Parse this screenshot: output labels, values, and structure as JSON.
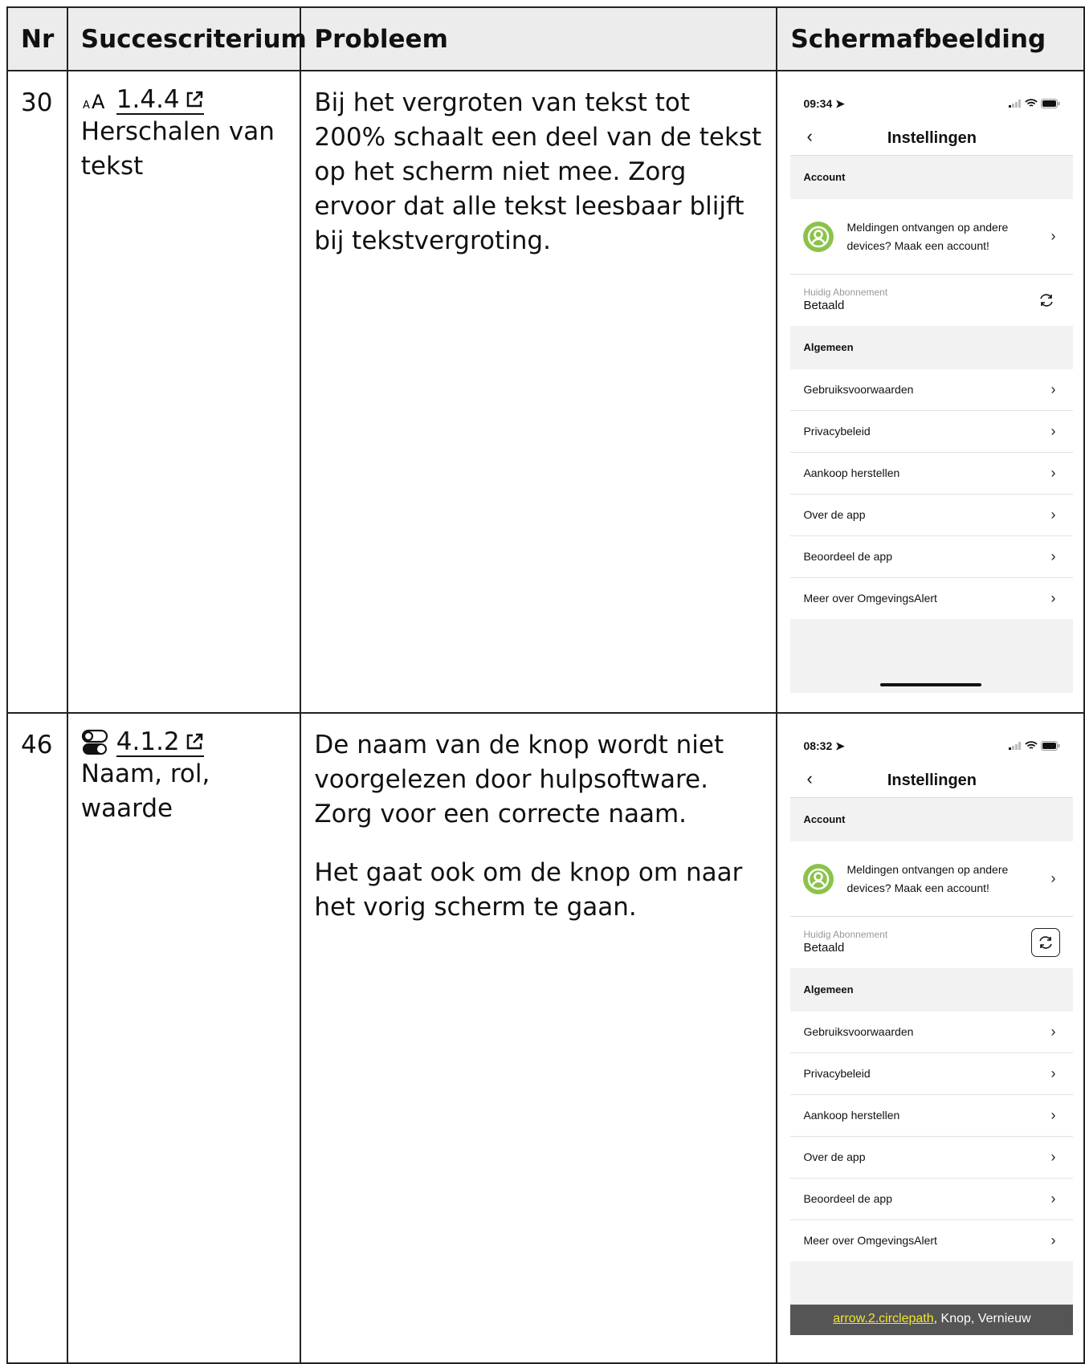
{
  "headers": {
    "nr": "Nr",
    "criterium": "Succescriterium",
    "probleem": "Probleem",
    "screenshot": "Schermafbeelding"
  },
  "rows": [
    {
      "nr": "30",
      "criterion_icon": "text-resize-icon",
      "criterion_code": "1.4.4",
      "criterion_name": "Herschalen van tekst",
      "problem": [
        "Bij het vergroten van tekst tot 200% schaalt een deel van de tekst op het scherm niet mee. Zorg ervoor dat alle tekst leesbaar blijft bij tekstvergroting."
      ],
      "phone": {
        "time": "09:34",
        "title": "Instellingen",
        "account_header": "Account",
        "account_text": "Meldingen ontvangen op andere devices? Maak een account!",
        "sub_label": "Huidig Abonnement",
        "sub_value": "Betaald",
        "general_header": "Algemeen",
        "menu": [
          "Gebruiksvoorwaarden",
          "Privacybeleid",
          "Aankoop herstellen",
          "Over de app",
          "Beoordeel de app",
          "Meer over OmgevingsAlert"
        ]
      }
    },
    {
      "nr": "46",
      "criterion_icon": "toggle-switch-icon",
      "criterion_code": "4.1.2",
      "criterion_name": "Naam, rol, waarde",
      "problem": [
        "De naam van de knop wordt niet voorgelezen door hulpsoftware. Zorg voor een correcte naam.",
        "Het gaat ook om de knop om naar het vorig scherm te gaan."
      ],
      "phone": {
        "time": "08:32",
        "title": "Instellingen",
        "account_header": "Account",
        "account_text": "Meldingen ontvangen op andere devices? Maak een account!",
        "sub_label": "Huidig Abonnement",
        "sub_value": "Betaald",
        "general_header": "Algemeen",
        "menu": [
          "Gebruiksvoorwaarden",
          "Privacybeleid",
          "Aankoop herstellen",
          "Over de app",
          "Beoordeel de app",
          "Meer over OmgevingsAlert"
        ],
        "voiceover_highlight": "arrow.2.circlepath",
        "voiceover_rest": ", Knop, Vernieuw"
      }
    }
  ]
}
